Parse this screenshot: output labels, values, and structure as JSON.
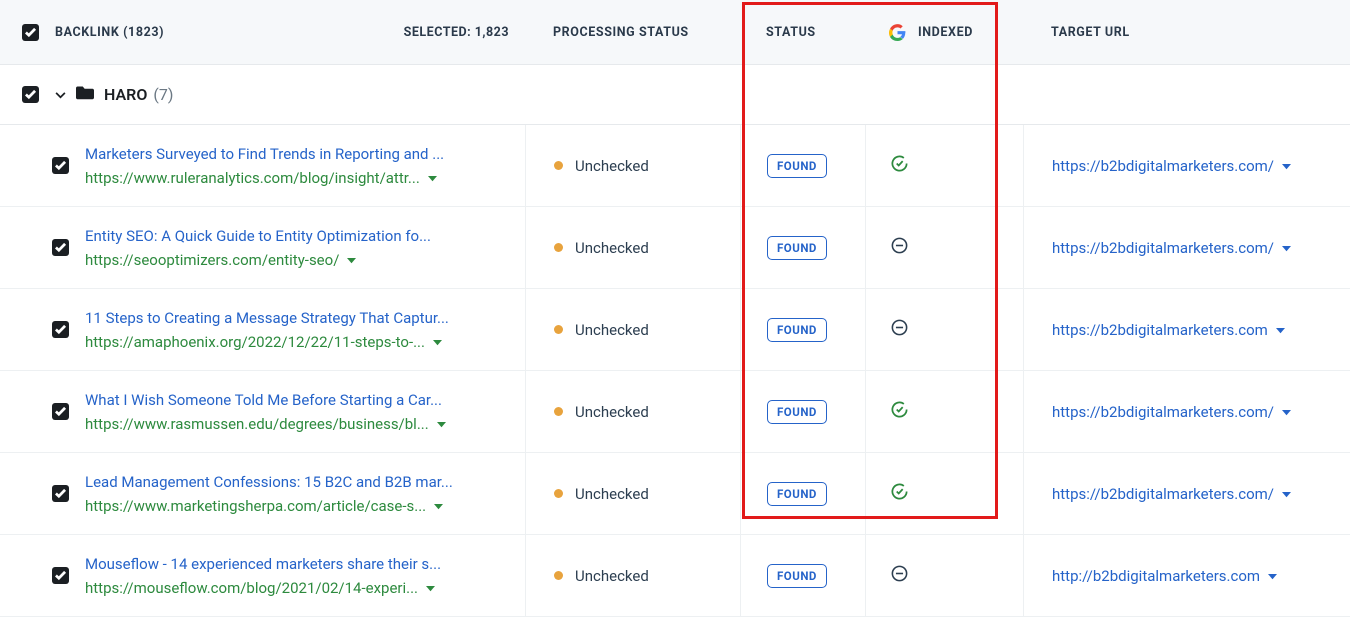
{
  "header": {
    "backlink_label": "BACKLINK (1823)",
    "selected_label": "SELECTED: 1,823",
    "processing_label": "PROCESSING STATUS",
    "status_label": "STATUS",
    "indexed_label": "INDEXED",
    "target_label": "TARGET URL"
  },
  "group": {
    "name": "HARO",
    "count": "(7)"
  },
  "processing_text": "Unchecked",
  "status_badge": "FOUND",
  "rows": [
    {
      "title": "Marketers Surveyed to Find Trends in Reporting and ...",
      "url": "https://www.ruleranalytics.com/blog/insight/attr...",
      "indexed": "yes",
      "target": "https://b2bdigitalmarketers.com/"
    },
    {
      "title": "Entity SEO: A Quick Guide to Entity Optimization fo...",
      "url": "https://seooptimizers.com/entity-seo/",
      "indexed": "no",
      "target": "https://b2bdigitalmarketers.com/"
    },
    {
      "title": "11 Steps to Creating a Message Strategy That Captur...",
      "url": "https://amaphoenix.org/2022/12/22/11-steps-to-...",
      "indexed": "no",
      "target": "https://b2bdigitalmarketers.com"
    },
    {
      "title": "What I Wish Someone Told Me Before Starting a Car...",
      "url": "https://www.rasmussen.edu/degrees/business/bl...",
      "indexed": "yes",
      "target": "https://b2bdigitalmarketers.com/"
    },
    {
      "title": "Lead Management Confessions: 15 B2C and B2B mar...",
      "url": "https://www.marketingsherpa.com/article/case-s...",
      "indexed": "yes",
      "target": "https://b2bdigitalmarketers.com/"
    },
    {
      "title": "Mouseflow - 14 experienced marketers share their s...",
      "url": "https://mouseflow.com/blog/2021/02/14-experi...",
      "indexed": "no",
      "target": "http://b2bdigitalmarketers.com"
    }
  ]
}
